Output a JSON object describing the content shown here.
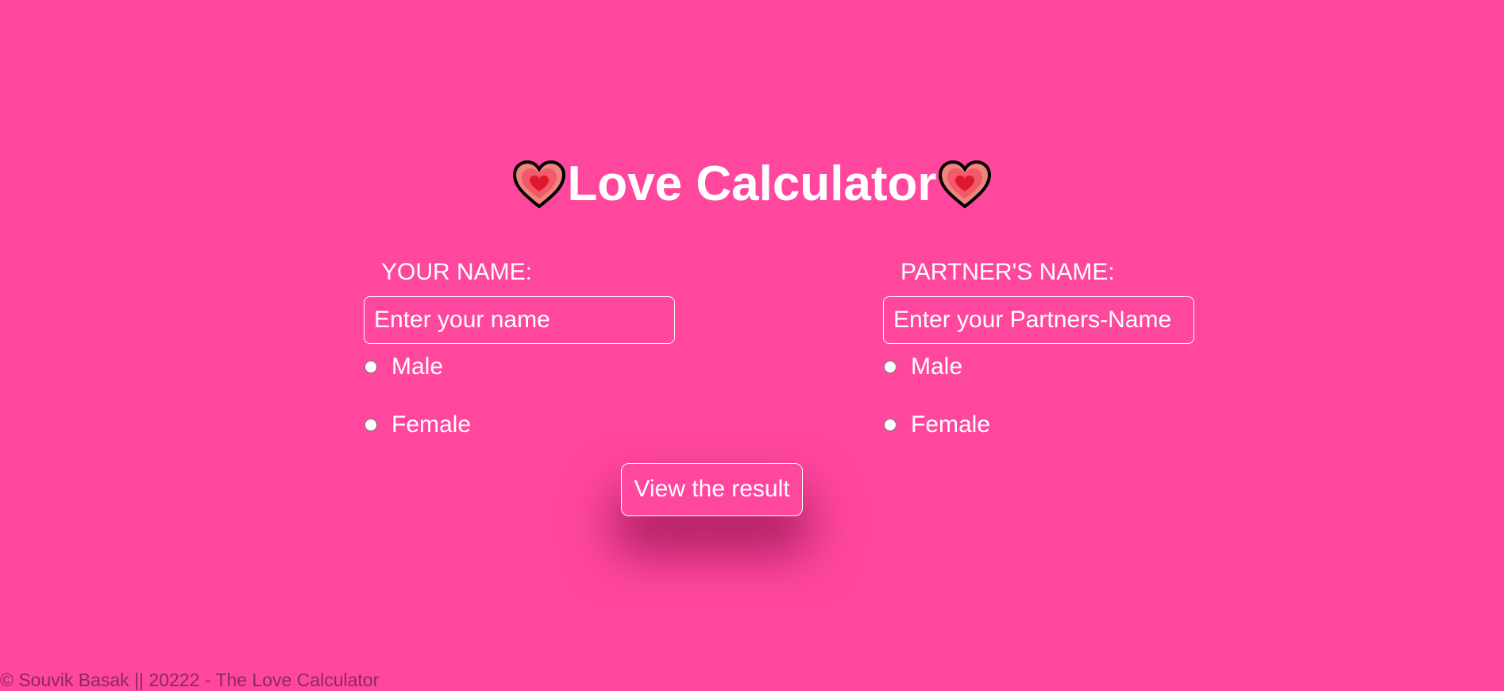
{
  "page": {
    "title": "Love Calculator",
    "title_icon": "heart-emoji-icon",
    "background_color": "#ff479e",
    "text_color": "#ffffff"
  },
  "your_name": {
    "label": "YOUR NAME:",
    "placeholder": "Enter your name",
    "value": "",
    "options": [
      "Male",
      "Female"
    ]
  },
  "partner_name": {
    "label": "PARTNER'S NAME:",
    "placeholder": "Enter your Partners-Name",
    "value": "",
    "options": [
      "Male",
      "Female"
    ]
  },
  "result_button": {
    "label": "View the result"
  },
  "footer": {
    "text": "© Souvik Basak || 20222 - The Love Calculator"
  }
}
